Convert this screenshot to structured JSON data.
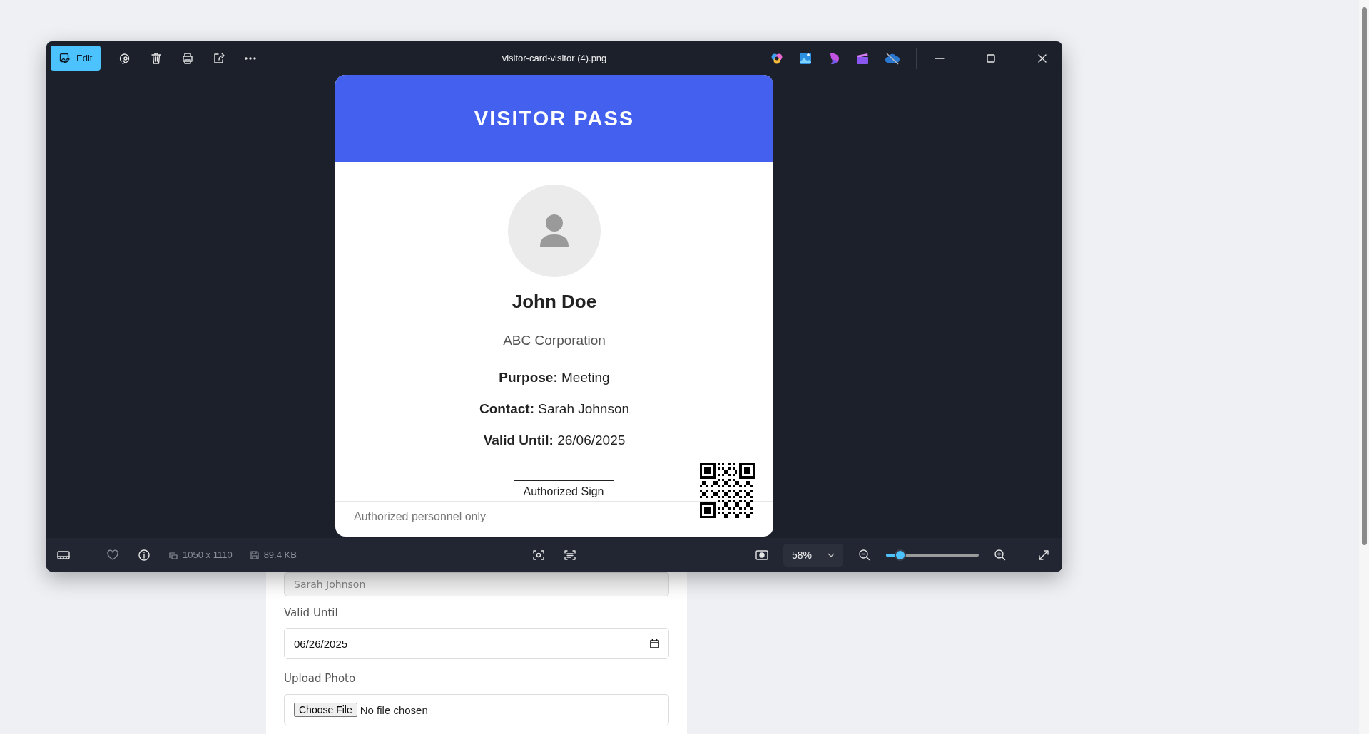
{
  "window": {
    "title": "visitor-card-visitor (4).png",
    "edit_label": "Edit"
  },
  "card": {
    "header": "VISITOR PASS",
    "name": "John Doe",
    "company": "ABC Corporation",
    "fields": [
      {
        "label": "Purpose:",
        "value": "Meeting"
      },
      {
        "label": "Contact:",
        "value": "Sarah Johnson"
      },
      {
        "label": "Valid Until:",
        "value": "26/06/2025"
      }
    ],
    "signature_label": "Authorized Sign",
    "footer": "Authorized personnel only"
  },
  "status_bar": {
    "dimensions": "1050 x 1110",
    "file_size": "89.4 KB",
    "zoom": "58%",
    "zoom_slider": {
      "level": 0.15
    }
  },
  "form": {
    "contact_value": "Sarah Johnson",
    "fields": [
      {
        "label": "Valid Until",
        "kind": "date",
        "value": "06/26/2025"
      },
      {
        "label": "Upload Photo",
        "kind": "file",
        "button": "Choose File",
        "status": "No file chosen"
      }
    ]
  }
}
